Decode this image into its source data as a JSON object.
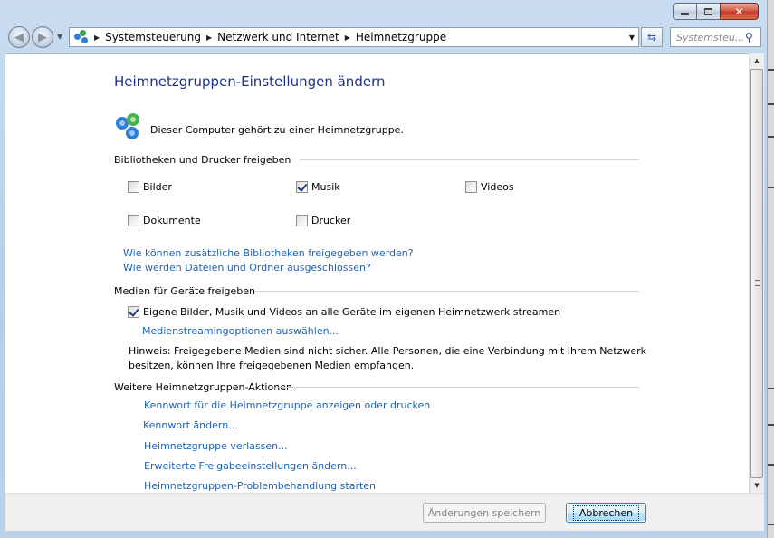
{
  "window": {
    "caption_buttons": [
      "minimize",
      "maximize",
      "close"
    ]
  },
  "nav": {
    "breadcrumbs": [
      "Systemsteuerung",
      "Netzwerk und Internet",
      "Heimnetzgruppe"
    ],
    "search_placeholder": "Systemsteu..."
  },
  "main": {
    "title": "Heimnetzgruppen-Einstellungen ändern",
    "membership_text": "Dieser Computer gehört zu einer Heimnetzgruppe."
  },
  "share_libraries": {
    "header": "Bibliotheken und Drucker freigeben",
    "items": [
      {
        "label": "Bilder",
        "checked": false
      },
      {
        "label": "Musik",
        "checked": true
      },
      {
        "label": "Videos",
        "checked": false
      },
      {
        "label": "Dokumente",
        "checked": false
      },
      {
        "label": "Drucker",
        "checked": false
      }
    ],
    "links": [
      "Wie können zusätzliche Bibliotheken freigegeben werden?",
      "Wie werden Dateien und Ordner ausgeschlossen?"
    ]
  },
  "media": {
    "header": "Medien für Geräte freigeben",
    "stream_label": "Eigene Bilder, Musik und Videos an alle Geräte im eigenen Heimnetzwerk streamen",
    "stream_checked": true,
    "options_link": "Medienstreamingoptionen auswählen...",
    "hint": "Hinweis: Freigegebene Medien sind nicht sicher. Alle Personen, die eine Verbindung mit Ihrem Netzwerk besitzen, können Ihre freigegebenen Medien empfangen."
  },
  "actions": {
    "header": "Weitere Heimnetzgruppen-Aktionen",
    "links": [
      "Kennwort für die Heimnetzgruppe anzeigen oder drucken",
      "Kennwort ändern...",
      "Heimnetzgruppe verlassen...",
      "Erweiterte Freigabeeinstellungen ändern...",
      "Heimnetzgruppen-Problembehandlung starten"
    ]
  },
  "buttons": {
    "save": "Änderungen speichern",
    "cancel": "Abbrechen"
  },
  "colors": {
    "title": "#1e3287",
    "link": "#1c63b7",
    "frame": "#b6cde6"
  }
}
